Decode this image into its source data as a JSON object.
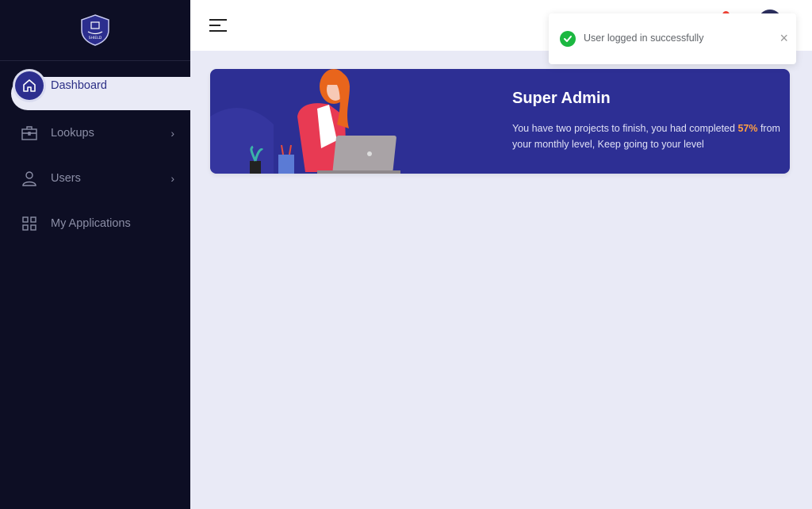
{
  "sidebar": {
    "logo_text": "SHIELD",
    "items": [
      {
        "label": "Dashboard",
        "icon": "home-icon",
        "active": true
      },
      {
        "label": "Lookups",
        "icon": "briefcase-icon",
        "chevron": true
      },
      {
        "label": "Users",
        "icon": "user-icon",
        "chevron": true
      },
      {
        "label": "My Applications",
        "icon": "grid-icon"
      }
    ]
  },
  "header": {
    "menu_icon": "hamburger-icon"
  },
  "banner": {
    "title": "Super Admin",
    "text_before": "You have two projects to finish, you had completed ",
    "percent": "57%",
    "text_after": " from your monthly level, Keep going to your level"
  },
  "toast": {
    "message": "User logged in successfully",
    "close": "×"
  },
  "colors": {
    "sidebar_bg": "#0d0e24",
    "accent": "#2c2e8e",
    "banner_bg": "#2d2f94",
    "highlight": "#ff9f43",
    "success": "#1cb841"
  }
}
